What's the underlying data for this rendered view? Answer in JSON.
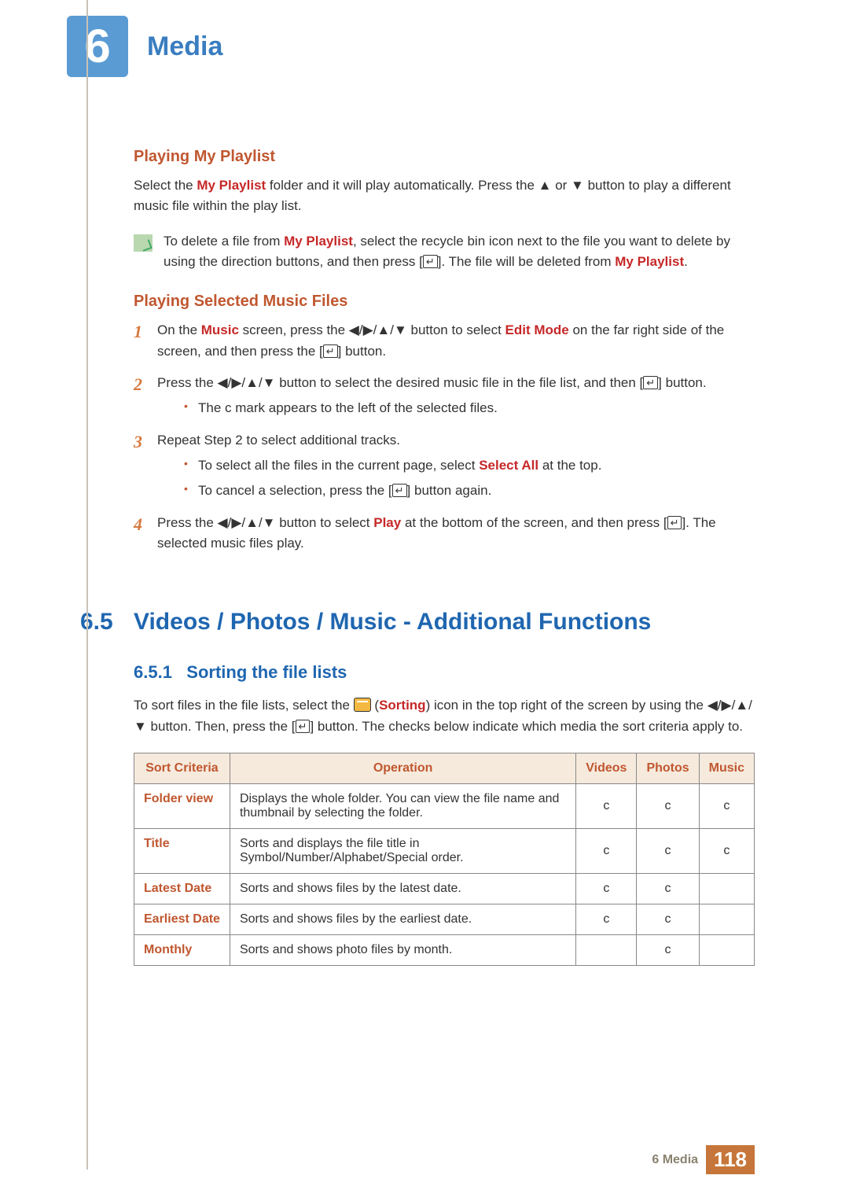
{
  "header": {
    "chapter_number": "6",
    "chapter_title": "Media"
  },
  "section_playing_playlist": {
    "title": "Playing My Playlist",
    "para_segments": [
      {
        "t": "Select the "
      },
      {
        "t": "My Playlist",
        "cls": "emph-red"
      },
      {
        "t": " folder and it will play automatically. Press the ▲ or ▼ button to play a different music file within the play list."
      }
    ],
    "note_segments": [
      {
        "t": "To delete a file from "
      },
      {
        "t": "My Playlist",
        "cls": "emph-red"
      },
      {
        "t": ", select the recycle bin icon next to the file you want to delete by using the direction buttons, and then press ["
      },
      {
        "t": "",
        "icon": "enter"
      },
      {
        "t": "]. The file will be deleted from "
      },
      {
        "t": "My Playlist",
        "cls": "emph-red"
      },
      {
        "t": "."
      }
    ]
  },
  "section_selected_music": {
    "title": "Playing Selected Music Files",
    "steps": [
      {
        "segments": [
          {
            "t": "On the "
          },
          {
            "t": "Music",
            "cls": "emph-red"
          },
          {
            "t": " screen, press the ◀/▶/▲/▼ button to select "
          },
          {
            "t": "Edit Mode",
            "cls": "emph-red"
          },
          {
            "t": " on the far right side of the screen, and then press the ["
          },
          {
            "t": "",
            "icon": "enter"
          },
          {
            "t": "] button."
          }
        ]
      },
      {
        "segments": [
          {
            "t": "Press the ◀/▶/▲/▼ button to select the desired music file in the file list, and then ["
          },
          {
            "t": "",
            "icon": "enter"
          },
          {
            "t": "] button."
          }
        ],
        "bullets": [
          [
            {
              "t": "The "
            },
            {
              "t": "c",
              "cls": "check"
            },
            {
              "t": " mark appears to the left of the selected files."
            }
          ]
        ]
      },
      {
        "segments": [
          {
            "t": "Repeat Step 2 to select additional tracks."
          }
        ],
        "bullets": [
          [
            {
              "t": "To select all the files in the current page, select "
            },
            {
              "t": "Select All",
              "cls": "emph-red"
            },
            {
              "t": " at the top."
            }
          ],
          [
            {
              "t": "To cancel a selection, press the ["
            },
            {
              "t": "",
              "icon": "enter"
            },
            {
              "t": "] button again."
            }
          ]
        ]
      },
      {
        "segments": [
          {
            "t": "Press the ◀/▶/▲/▼ button to select "
          },
          {
            "t": "Play",
            "cls": "emph-red"
          },
          {
            "t": " at the bottom of the screen, and then press ["
          },
          {
            "t": "",
            "icon": "enter"
          },
          {
            "t": "]. The selected music files play."
          }
        ]
      }
    ]
  },
  "section_6_5": {
    "number": "6.5",
    "title": "Videos / Photos / Music - Additional Functions",
    "subsection_number": "6.5.1",
    "subsection_title": "Sorting the file lists",
    "intro_segments": [
      {
        "t": "To sort files in the file lists, select the "
      },
      {
        "t": "",
        "icon": "sorting"
      },
      {
        "t": " ("
      },
      {
        "t": "Sorting",
        "cls": "sorting-red"
      },
      {
        "t": ") icon in the top right of the screen by using the ◀/▶/▲/▼ button. Then, press the ["
      },
      {
        "t": "",
        "icon": "enter"
      },
      {
        "t": "] button. The checks below indicate which media the sort criteria apply to."
      }
    ]
  },
  "chart_data": {
    "type": "table",
    "headers": [
      "Sort Criteria",
      "Operation",
      "Videos",
      "Photos",
      "Music"
    ],
    "rows": [
      {
        "criteria": "Folder view",
        "operation": "Displays the whole folder. You can view the file name and thumbnail by selecting the folder.",
        "videos": "c",
        "photos": "c",
        "music": "c"
      },
      {
        "criteria": "Title",
        "operation": "Sorts and displays the file title in Symbol/Number/Alphabet/Special order.",
        "videos": "c",
        "photos": "c",
        "music": "c"
      },
      {
        "criteria": "Latest Date",
        "operation": "Sorts and shows files by the latest date.",
        "videos": "c",
        "photos": "c",
        "music": ""
      },
      {
        "criteria": "Earliest Date",
        "operation": "Sorts and shows files by the earliest date.",
        "videos": "c",
        "photos": "c",
        "music": ""
      },
      {
        "criteria": "Monthly",
        "operation": "Sorts and shows photo files by month.",
        "videos": "",
        "photos": "c",
        "music": ""
      }
    ]
  },
  "footer": {
    "label": "6 Media",
    "page": "118"
  }
}
